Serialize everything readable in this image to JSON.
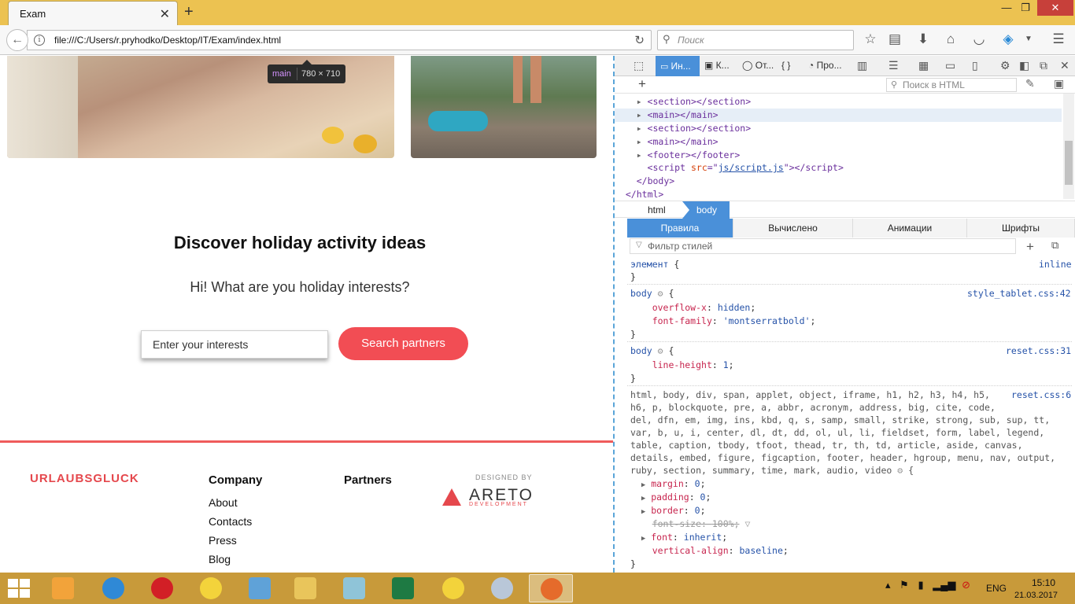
{
  "browser": {
    "tab_title": "Exam",
    "url": "file:///C:/Users/r.pryhodko/Desktop/IT/Exam/index.html",
    "search_placeholder": "Поиск"
  },
  "page": {
    "tooltip_tag": "main",
    "tooltip_dims": "780 × 710",
    "headline": "Discover holiday activity ideas",
    "subhead": "Hi! What are you holiday interests?",
    "input_placeholder": "Enter your interests",
    "search_button": "Search partners",
    "accent_color": "#f24d54",
    "footer": {
      "logo": "URLAUBSGLUCK",
      "company_heading": "Company",
      "company_links": [
        "About",
        "Contacts",
        "Press",
        "Blog"
      ],
      "partners_heading": "Partners",
      "designed_by": "DESIGNED BY",
      "areto": "ARETO",
      "areto_sub": "DEVELOPMENT"
    }
  },
  "devtools": {
    "tabs": [
      "Ин...",
      "К...",
      "От...",
      "Про..."
    ],
    "html_search_placeholder": "Поиск в HTML",
    "markup": {
      "section1": "section",
      "main1": "main",
      "section2": "section",
      "main2": "main",
      "footer": "footer",
      "script_tag": "script",
      "script_attr": "src",
      "script_src": "js/script.js",
      "body_close": "body",
      "html_close": "html"
    },
    "breadcrumbs": [
      "html",
      "body"
    ],
    "rule_tabs": [
      "Правила",
      "Вычислено",
      "Анимации",
      "Шрифты"
    ],
    "filter_placeholder": "Фильтр стилей",
    "rules": {
      "element_selector": "элемент",
      "element_source": "inline",
      "r1_selector": "body",
      "r1_source": "style_tablet.css:42",
      "r1_p1_name": "overflow-x",
      "r1_p1_value": "hidden",
      "r1_p2_name": "font-family",
      "r1_p2_value": "'montserratbold'",
      "r2_selector": "body",
      "r2_source": "reset.css:31",
      "r2_p1_name": "line-height",
      "r2_p1_value": "1",
      "r3_source": "reset.css:6",
      "r3_selector_lines": [
        "html, body, div, span, applet, object, iframe, h1, h2, h3, h4, h5,",
        "h6, p, blockquote, pre, a, abbr, acronym, address, big, cite, code,",
        "del, dfn, em, img, ins, kbd, q, s, samp, small, strike, strong, sub, sup, tt,",
        "var, b, u, i, center, dl, dt, dd, ol, ul, li, fieldset, form, label, legend,",
        "table, caption, tbody, tfoot, thead, tr, th, td, article, aside, canvas,",
        "details, embed, figure, figcaption, footer, header, hgroup, menu, nav, output,",
        "ruby, section, summary, time, mark, audio, video"
      ],
      "r3_props": [
        {
          "name": "margin",
          "value": "0"
        },
        {
          "name": "padding",
          "value": "0"
        },
        {
          "name": "border",
          "value": "0"
        },
        {
          "name": "font-size",
          "value": "100%"
        },
        {
          "name": "font",
          "value": "inherit"
        },
        {
          "name": "vertical-align",
          "value": "baseline"
        }
      ]
    }
  },
  "taskbar": {
    "lang": "ENG",
    "time": "15:10",
    "date": "21.03.2017"
  }
}
